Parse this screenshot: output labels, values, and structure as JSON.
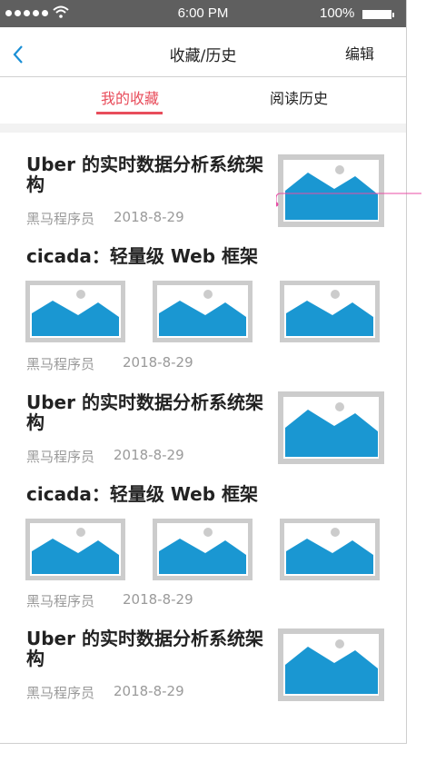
{
  "status_bar": {
    "time": "6:00 PM",
    "battery": "100%"
  },
  "nav": {
    "title": "收藏/历史",
    "edit_label": "编辑"
  },
  "tabs": [
    {
      "label": "我的收藏"
    },
    {
      "label": "阅读历史"
    }
  ],
  "articles": [
    {
      "title": "Uber 的实时数据分析系统架构",
      "author": "黑马程序员",
      "date": "2018-8-29"
    },
    {
      "title": "cicada：轻量级 Web 框架",
      "author": "黑马程序员",
      "date": "2018-8-29"
    },
    {
      "title": "Uber 的实时数据分析系统架构",
      "author": "黑马程序员",
      "date": "2018-8-29"
    },
    {
      "title": "cicada：轻量级 Web 框架",
      "author": "黑马程序员",
      "date": "2018-8-29"
    },
    {
      "title": "Uber 的实时数据分析系统架构",
      "author": "黑马程序员",
      "date": "2018-8-29"
    }
  ],
  "colors": {
    "accent": "#e84d5b",
    "link_blue": "#1a8fd6",
    "image_blue": "#1a97d2",
    "status_bar_bg": "#5f5f5f"
  },
  "icons": {
    "back": "chevron-left-icon",
    "image": "image-placeholder-icon",
    "wifi": "wifi-icon",
    "battery": "battery-icon"
  }
}
